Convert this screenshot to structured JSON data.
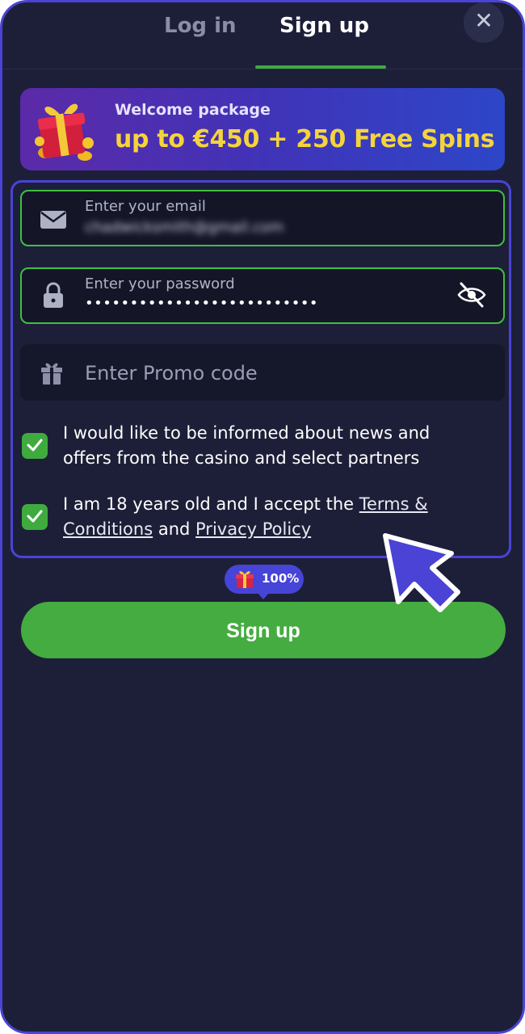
{
  "tabs": {
    "login_label": "Log in",
    "signup_label": "Sign up",
    "active": "signup"
  },
  "close": {
    "symbol": "✕"
  },
  "banner": {
    "label": "Welcome package",
    "offer": "up to €450 + 250 Free Spins",
    "icon": "gift-box-icon"
  },
  "form": {
    "email": {
      "label": "Enter your email",
      "value": "chadwicksmith@gmail.com",
      "icon": "envelope-icon"
    },
    "password": {
      "label": "Enter your password",
      "value": "••••••••••••••••••••••••••",
      "icon": "lock-icon",
      "toggle_icon": "eye-hidden-icon"
    },
    "promo": {
      "placeholder": "Enter Promo code",
      "icon": "gift-icon"
    },
    "news_consent": {
      "text": "I would like to be informed about news and offers from the casino and select partners",
      "checked": true
    },
    "terms_consent": {
      "text_before": "I am 18 years old and I accept the ",
      "terms_link": "Terms & Conditions",
      "text_middle": " and ",
      "privacy_link": "Privacy Policy",
      "checked": true
    }
  },
  "bonus_badge": {
    "text": "100%",
    "icon": "gift-icon"
  },
  "submit": {
    "label": "Sign up"
  },
  "colors": {
    "background": "#1d1f38",
    "accent_green": "#44ac40",
    "accent_purple": "#4a43d6",
    "offer_yellow": "#f5d43a"
  }
}
